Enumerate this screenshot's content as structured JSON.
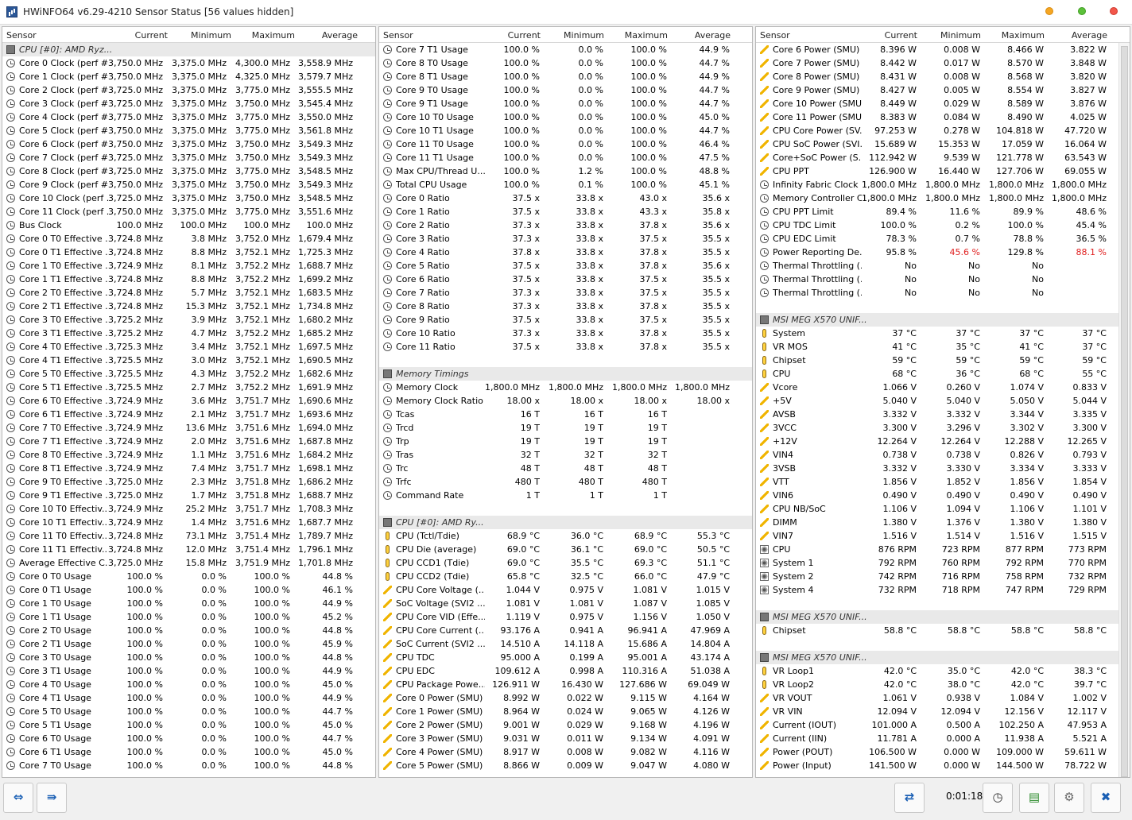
{
  "title": "HWiNFO64 v6.29-4210 Sensor Status [56 values hidden]",
  "headers": {
    "sensor": "Sensor",
    "current": "Current",
    "minimum": "Minimum",
    "maximum": "Maximum",
    "average": "Average"
  },
  "timer": "0:01:18",
  "icons": {
    "clock": "clock-icon",
    "temp": "thermometer-icon",
    "volt": "lightning-icon",
    "fan": "fan-icon",
    "chip": "chip-icon"
  },
  "col1": [
    [
      "g",
      "CPU [#0]: AMD Ryz...",
      "",
      "",
      "",
      ""
    ],
    [
      "c",
      "Core 0 Clock (perf #...",
      "3,750.0 MHz",
      "3,375.0 MHz",
      "4,300.0 MHz",
      "3,558.9 MHz"
    ],
    [
      "c",
      "Core 1 Clock (perf #...",
      "3,750.0 MHz",
      "3,375.0 MHz",
      "4,325.0 MHz",
      "3,579.7 MHz"
    ],
    [
      "c",
      "Core 2 Clock (perf #...",
      "3,725.0 MHz",
      "3,375.0 MHz",
      "3,775.0 MHz",
      "3,555.5 MHz"
    ],
    [
      "c",
      "Core 3 Clock (perf #...",
      "3,725.0 MHz",
      "3,375.0 MHz",
      "3,750.0 MHz",
      "3,545.4 MHz"
    ],
    [
      "c",
      "Core 4 Clock (perf #...",
      "3,775.0 MHz",
      "3,375.0 MHz",
      "3,775.0 MHz",
      "3,550.0 MHz"
    ],
    [
      "c",
      "Core 5 Clock (perf #...",
      "3,750.0 MHz",
      "3,375.0 MHz",
      "3,775.0 MHz",
      "3,561.8 MHz"
    ],
    [
      "c",
      "Core 6 Clock (perf #...",
      "3,750.0 MHz",
      "3,375.0 MHz",
      "3,750.0 MHz",
      "3,549.3 MHz"
    ],
    [
      "c",
      "Core 7 Clock (perf #...",
      "3,725.0 MHz",
      "3,375.0 MHz",
      "3,750.0 MHz",
      "3,549.3 MHz"
    ],
    [
      "c",
      "Core 8 Clock (perf #...",
      "3,725.0 MHz",
      "3,375.0 MHz",
      "3,775.0 MHz",
      "3,548.5 MHz"
    ],
    [
      "c",
      "Core 9 Clock (perf #...",
      "3,750.0 MHz",
      "3,375.0 MHz",
      "3,750.0 MHz",
      "3,549.3 MHz"
    ],
    [
      "c",
      "Core 10 Clock (perf ...",
      "3,725.0 MHz",
      "3,375.0 MHz",
      "3,750.0 MHz",
      "3,548.5 MHz"
    ],
    [
      "c",
      "Core 11 Clock (perf ...",
      "3,750.0 MHz",
      "3,375.0 MHz",
      "3,775.0 MHz",
      "3,551.6 MHz"
    ],
    [
      "c",
      "Bus Clock",
      "100.0 MHz",
      "100.0 MHz",
      "100.0 MHz",
      "100.0 MHz"
    ],
    [
      "c",
      "Core 0 T0 Effective ...",
      "3,724.8 MHz",
      "3.8 MHz",
      "3,752.0 MHz",
      "1,679.4 MHz"
    ],
    [
      "c",
      "Core 0 T1 Effective ...",
      "3,724.8 MHz",
      "8.8 MHz",
      "3,752.1 MHz",
      "1,725.3 MHz"
    ],
    [
      "c",
      "Core 1 T0 Effective ...",
      "3,724.9 MHz",
      "8.1 MHz",
      "3,752.2 MHz",
      "1,688.7 MHz"
    ],
    [
      "c",
      "Core 1 T1 Effective ...",
      "3,724.8 MHz",
      "8.8 MHz",
      "3,752.2 MHz",
      "1,699.2 MHz"
    ],
    [
      "c",
      "Core 2 T0 Effective ...",
      "3,724.8 MHz",
      "5.7 MHz",
      "3,752.1 MHz",
      "1,683.5 MHz"
    ],
    [
      "c",
      "Core 2 T1 Effective ...",
      "3,724.8 MHz",
      "15.3 MHz",
      "3,752.1 MHz",
      "1,734.8 MHz"
    ],
    [
      "c",
      "Core 3 T0 Effective ...",
      "3,725.2 MHz",
      "3.9 MHz",
      "3,752.1 MHz",
      "1,680.2 MHz"
    ],
    [
      "c",
      "Core 3 T1 Effective ...",
      "3,725.2 MHz",
      "4.7 MHz",
      "3,752.2 MHz",
      "1,685.2 MHz"
    ],
    [
      "c",
      "Core 4 T0 Effective ...",
      "3,725.3 MHz",
      "3.4 MHz",
      "3,752.1 MHz",
      "1,697.5 MHz"
    ],
    [
      "c",
      "Core 4 T1 Effective ...",
      "3,725.5 MHz",
      "3.0 MHz",
      "3,752.1 MHz",
      "1,690.5 MHz"
    ],
    [
      "c",
      "Core 5 T0 Effective ...",
      "3,725.5 MHz",
      "4.3 MHz",
      "3,752.2 MHz",
      "1,682.6 MHz"
    ],
    [
      "c",
      "Core 5 T1 Effective ...",
      "3,725.5 MHz",
      "2.7 MHz",
      "3,752.2 MHz",
      "1,691.9 MHz"
    ],
    [
      "c",
      "Core 6 T0 Effective ...",
      "3,724.9 MHz",
      "3.6 MHz",
      "3,751.7 MHz",
      "1,690.6 MHz"
    ],
    [
      "c",
      "Core 6 T1 Effective ...",
      "3,724.9 MHz",
      "2.1 MHz",
      "3,751.7 MHz",
      "1,693.6 MHz"
    ],
    [
      "c",
      "Core 7 T0 Effective ...",
      "3,724.9 MHz",
      "13.6 MHz",
      "3,751.6 MHz",
      "1,694.0 MHz"
    ],
    [
      "c",
      "Core 7 T1 Effective ...",
      "3,724.9 MHz",
      "2.0 MHz",
      "3,751.6 MHz",
      "1,687.8 MHz"
    ],
    [
      "c",
      "Core 8 T0 Effective ...",
      "3,724.9 MHz",
      "1.1 MHz",
      "3,751.6 MHz",
      "1,684.2 MHz"
    ],
    [
      "c",
      "Core 8 T1 Effective ...",
      "3,724.9 MHz",
      "7.4 MHz",
      "3,751.7 MHz",
      "1,698.1 MHz"
    ],
    [
      "c",
      "Core 9 T0 Effective ...",
      "3,725.0 MHz",
      "2.3 MHz",
      "3,751.8 MHz",
      "1,686.2 MHz"
    ],
    [
      "c",
      "Core 9 T1 Effective ...",
      "3,725.0 MHz",
      "1.7 MHz",
      "3,751.8 MHz",
      "1,688.7 MHz"
    ],
    [
      "c",
      "Core 10 T0 Effectiv...",
      "3,724.9 MHz",
      "25.2 MHz",
      "3,751.7 MHz",
      "1,708.3 MHz"
    ],
    [
      "c",
      "Core 10 T1 Effectiv...",
      "3,724.9 MHz",
      "1.4 MHz",
      "3,751.6 MHz",
      "1,687.7 MHz"
    ],
    [
      "c",
      "Core 11 T0 Effectiv...",
      "3,724.8 MHz",
      "73.1 MHz",
      "3,751.4 MHz",
      "1,789.7 MHz"
    ],
    [
      "c",
      "Core 11 T1 Effectiv...",
      "3,724.8 MHz",
      "12.0 MHz",
      "3,751.4 MHz",
      "1,796.1 MHz"
    ],
    [
      "c",
      "Average Effective C...",
      "3,725.0 MHz",
      "15.8 MHz",
      "3,751.9 MHz",
      "1,701.8 MHz"
    ],
    [
      "c",
      "Core 0 T0 Usage",
      "100.0 %",
      "0.0 %",
      "100.0 %",
      "44.8 %"
    ],
    [
      "c",
      "Core 0 T1 Usage",
      "100.0 %",
      "0.0 %",
      "100.0 %",
      "46.1 %"
    ],
    [
      "c",
      "Core 1 T0 Usage",
      "100.0 %",
      "0.0 %",
      "100.0 %",
      "44.9 %"
    ],
    [
      "c",
      "Core 1 T1 Usage",
      "100.0 %",
      "0.0 %",
      "100.0 %",
      "45.2 %"
    ],
    [
      "c",
      "Core 2 T0 Usage",
      "100.0 %",
      "0.0 %",
      "100.0 %",
      "44.8 %"
    ],
    [
      "c",
      "Core 2 T1 Usage",
      "100.0 %",
      "0.0 %",
      "100.0 %",
      "45.9 %"
    ],
    [
      "c",
      "Core 3 T0 Usage",
      "100.0 %",
      "0.0 %",
      "100.0 %",
      "44.8 %"
    ],
    [
      "c",
      "Core 3 T1 Usage",
      "100.0 %",
      "0.0 %",
      "100.0 %",
      "44.9 %"
    ],
    [
      "c",
      "Core 4 T0 Usage",
      "100.0 %",
      "0.0 %",
      "100.0 %",
      "45.0 %"
    ],
    [
      "c",
      "Core 4 T1 Usage",
      "100.0 %",
      "0.0 %",
      "100.0 %",
      "44.9 %"
    ],
    [
      "c",
      "Core 5 T0 Usage",
      "100.0 %",
      "0.0 %",
      "100.0 %",
      "44.7 %"
    ],
    [
      "c",
      "Core 5 T1 Usage",
      "100.0 %",
      "0.0 %",
      "100.0 %",
      "45.0 %"
    ],
    [
      "c",
      "Core 6 T0 Usage",
      "100.0 %",
      "0.0 %",
      "100.0 %",
      "44.7 %"
    ],
    [
      "c",
      "Core 6 T1 Usage",
      "100.0 %",
      "0.0 %",
      "100.0 %",
      "45.0 %"
    ],
    [
      "c",
      "Core 7 T0 Usage",
      "100.0 %",
      "0.0 %",
      "100.0 %",
      "44.8 %"
    ]
  ],
  "col2": [
    [
      "c",
      "Core 7 T1 Usage",
      "100.0 %",
      "0.0 %",
      "100.0 %",
      "44.9 %"
    ],
    [
      "c",
      "Core 8 T0 Usage",
      "100.0 %",
      "0.0 %",
      "100.0 %",
      "44.7 %"
    ],
    [
      "c",
      "Core 8 T1 Usage",
      "100.0 %",
      "0.0 %",
      "100.0 %",
      "44.9 %"
    ],
    [
      "c",
      "Core 9 T0 Usage",
      "100.0 %",
      "0.0 %",
      "100.0 %",
      "44.7 %"
    ],
    [
      "c",
      "Core 9 T1 Usage",
      "100.0 %",
      "0.0 %",
      "100.0 %",
      "44.7 %"
    ],
    [
      "c",
      "Core 10 T0 Usage",
      "100.0 %",
      "0.0 %",
      "100.0 %",
      "45.0 %"
    ],
    [
      "c",
      "Core 10 T1 Usage",
      "100.0 %",
      "0.0 %",
      "100.0 %",
      "44.7 %"
    ],
    [
      "c",
      "Core 11 T0 Usage",
      "100.0 %",
      "0.0 %",
      "100.0 %",
      "46.4 %"
    ],
    [
      "c",
      "Core 11 T1 Usage",
      "100.0 %",
      "0.0 %",
      "100.0 %",
      "47.5 %"
    ],
    [
      "c",
      "Max CPU/Thread U...",
      "100.0 %",
      "1.2 %",
      "100.0 %",
      "48.8 %"
    ],
    [
      "c",
      "Total CPU Usage",
      "100.0 %",
      "0.1 %",
      "100.0 %",
      "45.1 %"
    ],
    [
      "c",
      "Core 0 Ratio",
      "37.5 x",
      "33.8 x",
      "43.0 x",
      "35.6 x"
    ],
    [
      "c",
      "Core 1 Ratio",
      "37.5 x",
      "33.8 x",
      "43.3 x",
      "35.8 x"
    ],
    [
      "c",
      "Core 2 Ratio",
      "37.3 x",
      "33.8 x",
      "37.8 x",
      "35.6 x"
    ],
    [
      "c",
      "Core 3 Ratio",
      "37.3 x",
      "33.8 x",
      "37.5 x",
      "35.5 x"
    ],
    [
      "c",
      "Core 4 Ratio",
      "37.8 x",
      "33.8 x",
      "37.8 x",
      "35.5 x"
    ],
    [
      "c",
      "Core 5 Ratio",
      "37.5 x",
      "33.8 x",
      "37.8 x",
      "35.6 x"
    ],
    [
      "c",
      "Core 6 Ratio",
      "37.5 x",
      "33.8 x",
      "37.5 x",
      "35.5 x"
    ],
    [
      "c",
      "Core 7 Ratio",
      "37.3 x",
      "33.8 x",
      "37.5 x",
      "35.5 x"
    ],
    [
      "c",
      "Core 8 Ratio",
      "37.3 x",
      "33.8 x",
      "37.8 x",
      "35.5 x"
    ],
    [
      "c",
      "Core 9 Ratio",
      "37.5 x",
      "33.8 x",
      "37.5 x",
      "35.5 x"
    ],
    [
      "c",
      "Core 10 Ratio",
      "37.3 x",
      "33.8 x",
      "37.8 x",
      "35.5 x"
    ],
    [
      "c",
      "Core 11 Ratio",
      "37.5 x",
      "33.8 x",
      "37.8 x",
      "35.5 x"
    ],
    [
      "b",
      "",
      "",
      "",
      "",
      ""
    ],
    [
      "g",
      "Memory Timings",
      "",
      "",
      "",
      ""
    ],
    [
      "c",
      "Memory Clock",
      "1,800.0 MHz",
      "1,800.0 MHz",
      "1,800.0 MHz",
      "1,800.0 MHz"
    ],
    [
      "c",
      "Memory Clock Ratio",
      "18.00 x",
      "18.00 x",
      "18.00 x",
      "18.00 x"
    ],
    [
      "c",
      "Tcas",
      "16 T",
      "16 T",
      "16 T",
      ""
    ],
    [
      "c",
      "Trcd",
      "19 T",
      "19 T",
      "19 T",
      ""
    ],
    [
      "c",
      "Trp",
      "19 T",
      "19 T",
      "19 T",
      ""
    ],
    [
      "c",
      "Tras",
      "32 T",
      "32 T",
      "32 T",
      ""
    ],
    [
      "c",
      "Trc",
      "48 T",
      "48 T",
      "48 T",
      ""
    ],
    [
      "c",
      "Trfc",
      "480 T",
      "480 T",
      "480 T",
      ""
    ],
    [
      "c",
      "Command Rate",
      "1 T",
      "1 T",
      "1 T",
      ""
    ],
    [
      "b",
      "",
      "",
      "",
      "",
      ""
    ],
    [
      "g",
      "CPU [#0]: AMD Ry...",
      "",
      "",
      "",
      ""
    ],
    [
      "t",
      "CPU (Tctl/Tdie)",
      "68.9 °C",
      "36.0 °C",
      "68.9 °C",
      "55.3 °C"
    ],
    [
      "t",
      "CPU Die (average)",
      "69.0 °C",
      "36.1 °C",
      "69.0 °C",
      "50.5 °C"
    ],
    [
      "t",
      "CPU CCD1 (Tdie)",
      "69.0 °C",
      "35.5 °C",
      "69.3 °C",
      "51.1 °C"
    ],
    [
      "t",
      "CPU CCD2 (Tdie)",
      "65.8 °C",
      "32.5 °C",
      "66.0 °C",
      "47.9 °C"
    ],
    [
      "v",
      "CPU Core Voltage (...",
      "1.044 V",
      "0.975 V",
      "1.081 V",
      "1.015 V"
    ],
    [
      "v",
      "SoC Voltage (SVI2 ...",
      "1.081 V",
      "1.081 V",
      "1.087 V",
      "1.085 V"
    ],
    [
      "v",
      "CPU Core VID (Effe...",
      "1.119 V",
      "0.975 V",
      "1.156 V",
      "1.050 V"
    ],
    [
      "v",
      "CPU Core Current (...",
      "93.176 A",
      "0.941 A",
      "96.941 A",
      "47.969 A"
    ],
    [
      "v",
      "SoC Current (SVI2 ...",
      "14.510 A",
      "14.118 A",
      "15.686 A",
      "14.804 A"
    ],
    [
      "v",
      "CPU TDC",
      "95.000 A",
      "0.199 A",
      "95.001 A",
      "43.174 A"
    ],
    [
      "v",
      "CPU EDC",
      "109.612 A",
      "0.998 A",
      "110.316 A",
      "51.038 A"
    ],
    [
      "v",
      "CPU Package Powe...",
      "126.911 W",
      "16.430 W",
      "127.686 W",
      "69.049 W"
    ],
    [
      "v",
      "Core 0 Power (SMU)",
      "8.992 W",
      "0.022 W",
      "9.115 W",
      "4.164 W"
    ],
    [
      "v",
      "Core 1 Power (SMU)",
      "8.964 W",
      "0.024 W",
      "9.065 W",
      "4.126 W"
    ],
    [
      "v",
      "Core 2 Power (SMU)",
      "9.001 W",
      "0.029 W",
      "9.168 W",
      "4.196 W"
    ],
    [
      "v",
      "Core 3 Power (SMU)",
      "9.031 W",
      "0.011 W",
      "9.134 W",
      "4.091 W"
    ],
    [
      "v",
      "Core 4 Power (SMU)",
      "8.917 W",
      "0.008 W",
      "9.082 W",
      "4.116 W"
    ],
    [
      "v",
      "Core 5 Power (SMU)",
      "8.866 W",
      "0.009 W",
      "9.047 W",
      "4.080 W"
    ]
  ],
  "col3": [
    [
      "v",
      "Core 6 Power (SMU)",
      "8.396 W",
      "0.008 W",
      "8.466 W",
      "3.822 W"
    ],
    [
      "v",
      "Core 7 Power (SMU)",
      "8.442 W",
      "0.017 W",
      "8.570 W",
      "3.848 W"
    ],
    [
      "v",
      "Core 8 Power (SMU)",
      "8.431 W",
      "0.008 W",
      "8.568 W",
      "3.820 W"
    ],
    [
      "v",
      "Core 9 Power (SMU)",
      "8.427 W",
      "0.005 W",
      "8.554 W",
      "3.827 W"
    ],
    [
      "v",
      "Core 10 Power (SMU)",
      "8.449 W",
      "0.029 W",
      "8.589 W",
      "3.876 W"
    ],
    [
      "v",
      "Core 11 Power (SMU)",
      "8.383 W",
      "0.084 W",
      "8.490 W",
      "4.025 W"
    ],
    [
      "v",
      "CPU Core Power (SV...",
      "97.253 W",
      "0.278 W",
      "104.818 W",
      "47.720 W"
    ],
    [
      "v",
      "CPU SoC Power (SVI...",
      "15.689 W",
      "15.353 W",
      "17.059 W",
      "16.064 W"
    ],
    [
      "v",
      "Core+SoC Power (S...",
      "112.942 W",
      "9.539 W",
      "121.778 W",
      "63.543 W"
    ],
    [
      "v",
      "CPU PPT",
      "126.900 W",
      "16.440 W",
      "127.706 W",
      "69.055 W"
    ],
    [
      "c",
      "Infinity Fabric Clock ...",
      "1,800.0 MHz",
      "1,800.0 MHz",
      "1,800.0 MHz",
      "1,800.0 MHz"
    ],
    [
      "c",
      "Memory Controller C...",
      "1,800.0 MHz",
      "1,800.0 MHz",
      "1,800.0 MHz",
      "1,800.0 MHz"
    ],
    [
      "c",
      "CPU PPT Limit",
      "89.4 %",
      "11.6 %",
      "89.9 %",
      "48.6 %"
    ],
    [
      "c",
      "CPU TDC Limit",
      "100.0 %",
      "0.2 %",
      "100.0 %",
      "45.4 %"
    ],
    [
      "c",
      "CPU EDC Limit",
      "78.3 %",
      "0.7 %",
      "78.8 %",
      "36.5 %"
    ],
    [
      "c",
      "Power Reporting De...",
      "95.8 %",
      "45.6 %",
      "129.8 %",
      "88.1 %"
    ],
    [
      "c",
      "Thermal Throttling (...",
      "No",
      "No",
      "No",
      ""
    ],
    [
      "c",
      "Thermal Throttling (...",
      "No",
      "No",
      "No",
      ""
    ],
    [
      "c",
      "Thermal Throttling (...",
      "No",
      "No",
      "No",
      ""
    ],
    [
      "b",
      "",
      "",
      "",
      "",
      ""
    ],
    [
      "g",
      "MSI MEG X570 UNIF...",
      "",
      "",
      "",
      ""
    ],
    [
      "t",
      "System",
      "37 °C",
      "37 °C",
      "37 °C",
      "37 °C"
    ],
    [
      "t",
      "VR MOS",
      "41 °C",
      "35 °C",
      "41 °C",
      "37 °C"
    ],
    [
      "t",
      "Chipset",
      "59 °C",
      "59 °C",
      "59 °C",
      "59 °C"
    ],
    [
      "t",
      "CPU",
      "68 °C",
      "36 °C",
      "68 °C",
      "55 °C"
    ],
    [
      "v",
      "Vcore",
      "1.066 V",
      "0.260 V",
      "1.074 V",
      "0.833 V"
    ],
    [
      "v",
      "+5V",
      "5.040 V",
      "5.040 V",
      "5.050 V",
      "5.044 V"
    ],
    [
      "v",
      "AVSB",
      "3.332 V",
      "3.332 V",
      "3.344 V",
      "3.335 V"
    ],
    [
      "v",
      "3VCC",
      "3.300 V",
      "3.296 V",
      "3.302 V",
      "3.300 V"
    ],
    [
      "v",
      "+12V",
      "12.264 V",
      "12.264 V",
      "12.288 V",
      "12.265 V"
    ],
    [
      "v",
      "VIN4",
      "0.738 V",
      "0.738 V",
      "0.826 V",
      "0.793 V"
    ],
    [
      "v",
      "3VSB",
      "3.332 V",
      "3.330 V",
      "3.334 V",
      "3.333 V"
    ],
    [
      "v",
      "VTT",
      "1.856 V",
      "1.852 V",
      "1.856 V",
      "1.854 V"
    ],
    [
      "v",
      "VIN6",
      "0.490 V",
      "0.490 V",
      "0.490 V",
      "0.490 V"
    ],
    [
      "v",
      "CPU NB/SoC",
      "1.106 V",
      "1.094 V",
      "1.106 V",
      "1.101 V"
    ],
    [
      "v",
      "DIMM",
      "1.380 V",
      "1.376 V",
      "1.380 V",
      "1.380 V"
    ],
    [
      "v",
      "VIN7",
      "1.516 V",
      "1.514 V",
      "1.516 V",
      "1.515 V"
    ],
    [
      "f",
      "CPU",
      "876 RPM",
      "723 RPM",
      "877 RPM",
      "773 RPM"
    ],
    [
      "f",
      "System 1",
      "792 RPM",
      "760 RPM",
      "792 RPM",
      "770 RPM"
    ],
    [
      "f",
      "System 2",
      "742 RPM",
      "716 RPM",
      "758 RPM",
      "732 RPM"
    ],
    [
      "f",
      "System 4",
      "732 RPM",
      "718 RPM",
      "747 RPM",
      "729 RPM"
    ],
    [
      "b",
      "",
      "",
      "",
      "",
      ""
    ],
    [
      "g",
      "MSI MEG X570 UNIF...",
      "",
      "",
      "",
      ""
    ],
    [
      "t",
      "Chipset",
      "58.8 °C",
      "58.8 °C",
      "58.8 °C",
      "58.8 °C"
    ],
    [
      "b",
      "",
      "",
      "",
      "",
      ""
    ],
    [
      "g",
      "MSI MEG X570 UNIF...",
      "",
      "",
      "",
      ""
    ],
    [
      "t",
      "VR Loop1",
      "42.0 °C",
      "35.0 °C",
      "42.0 °C",
      "38.3 °C"
    ],
    [
      "t",
      "VR Loop2",
      "42.0 °C",
      "38.0 °C",
      "42.0 °C",
      "39.7 °C"
    ],
    [
      "v",
      "VR VOUT",
      "1.061 V",
      "0.938 V",
      "1.084 V",
      "1.002 V"
    ],
    [
      "v",
      "VR VIN",
      "12.094 V",
      "12.094 V",
      "12.156 V",
      "12.117 V"
    ],
    [
      "v",
      "Current (IOUT)",
      "101.000 A",
      "0.500 A",
      "102.250 A",
      "47.953 A"
    ],
    [
      "v",
      "Current (IIN)",
      "11.781 A",
      "0.000 A",
      "11.938 A",
      "5.521 A"
    ],
    [
      "v",
      "Power (POUT)",
      "106.500 W",
      "0.000 W",
      "109.000 W",
      "59.611 W"
    ],
    [
      "v",
      "Power (Input)",
      "141.500 W",
      "0.000 W",
      "144.500 W",
      "78.722 W"
    ]
  ],
  "highlights": {
    "red_color": "#e02020",
    "col3_row15_min": "45.6 %",
    "col3_row15_avg": "88.1 %"
  }
}
